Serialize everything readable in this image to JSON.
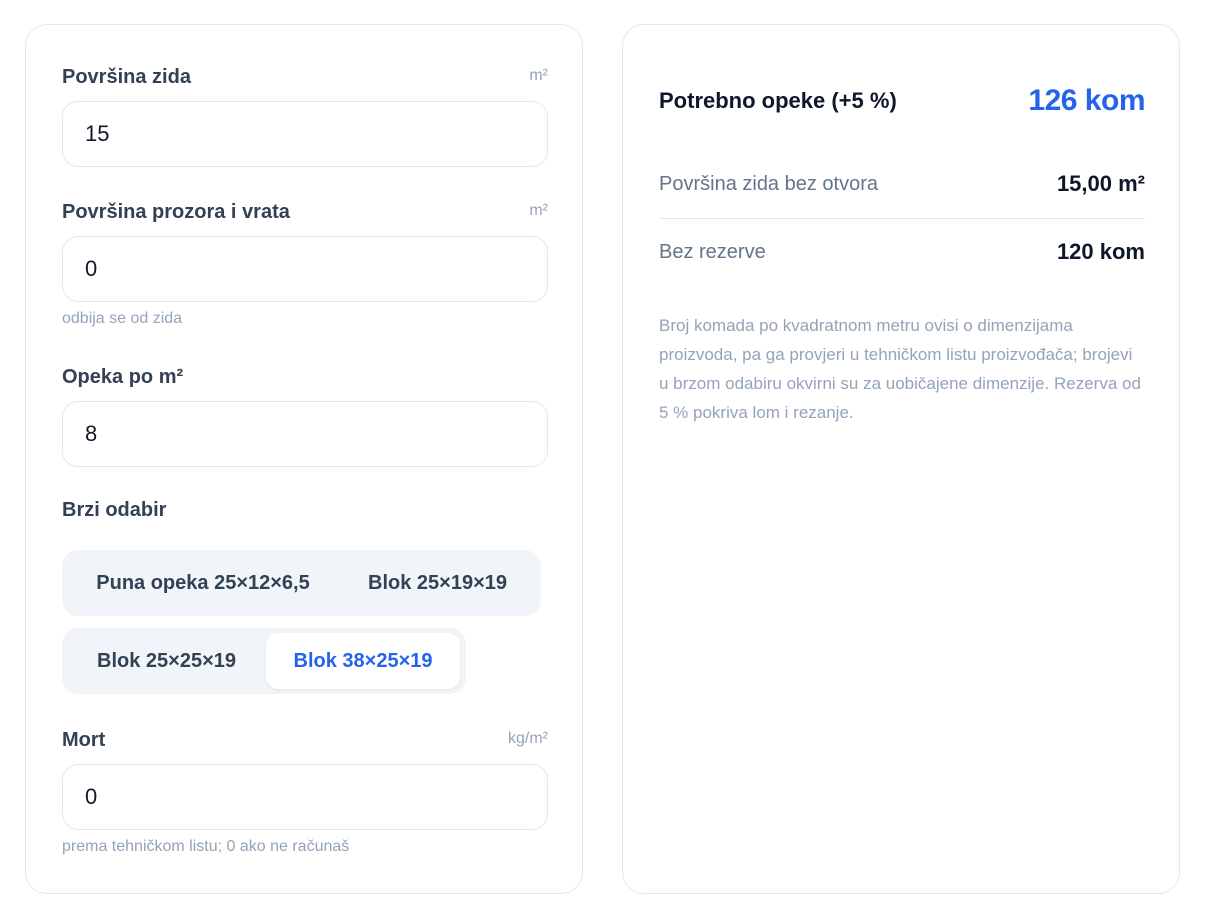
{
  "form": {
    "wall_area": {
      "label": "Površina zida",
      "unit": "m²",
      "value": "15"
    },
    "openings_area": {
      "label": "Površina prozora i vrata",
      "unit": "m²",
      "value": "0",
      "hint": "odbija se od zida"
    },
    "bricks_per_m2": {
      "label": "Opeka po m²",
      "value": "8"
    },
    "quick_pick": {
      "title": "Brzi odabir",
      "options": [
        "Puna opeka 25×12×6,5",
        "Blok 25×19×19",
        "Blok 25×25×19",
        "Blok 38×25×19"
      ],
      "selected": "Blok 38×25×19"
    },
    "mortar": {
      "label": "Mort",
      "unit": "kg/m²",
      "value": "0",
      "hint": "prema tehničkom listu; 0 ako ne računaš"
    }
  },
  "results": {
    "title": "Potrebno opeke (+5 %)",
    "total": "126 kom",
    "rows": [
      {
        "label": "Površina zida bez otvora",
        "value": "15,00 m²"
      },
      {
        "label": "Bez rezerve",
        "value": "120 kom"
      }
    ],
    "note": "Broj komada po kvadratnom metru ovisi o dimenzijama proizvoda, pa ga provjeri u tehničkom listu proizvođača; brojevi u brzom odabiru okvirni su za uobičajene dimenzije. Rezerva od 5 % pokriva lom i rezanje."
  },
  "colors": {
    "accent": "#2563eb",
    "border": "#e5e7eb",
    "segment_bg": "#f1f5f9"
  }
}
